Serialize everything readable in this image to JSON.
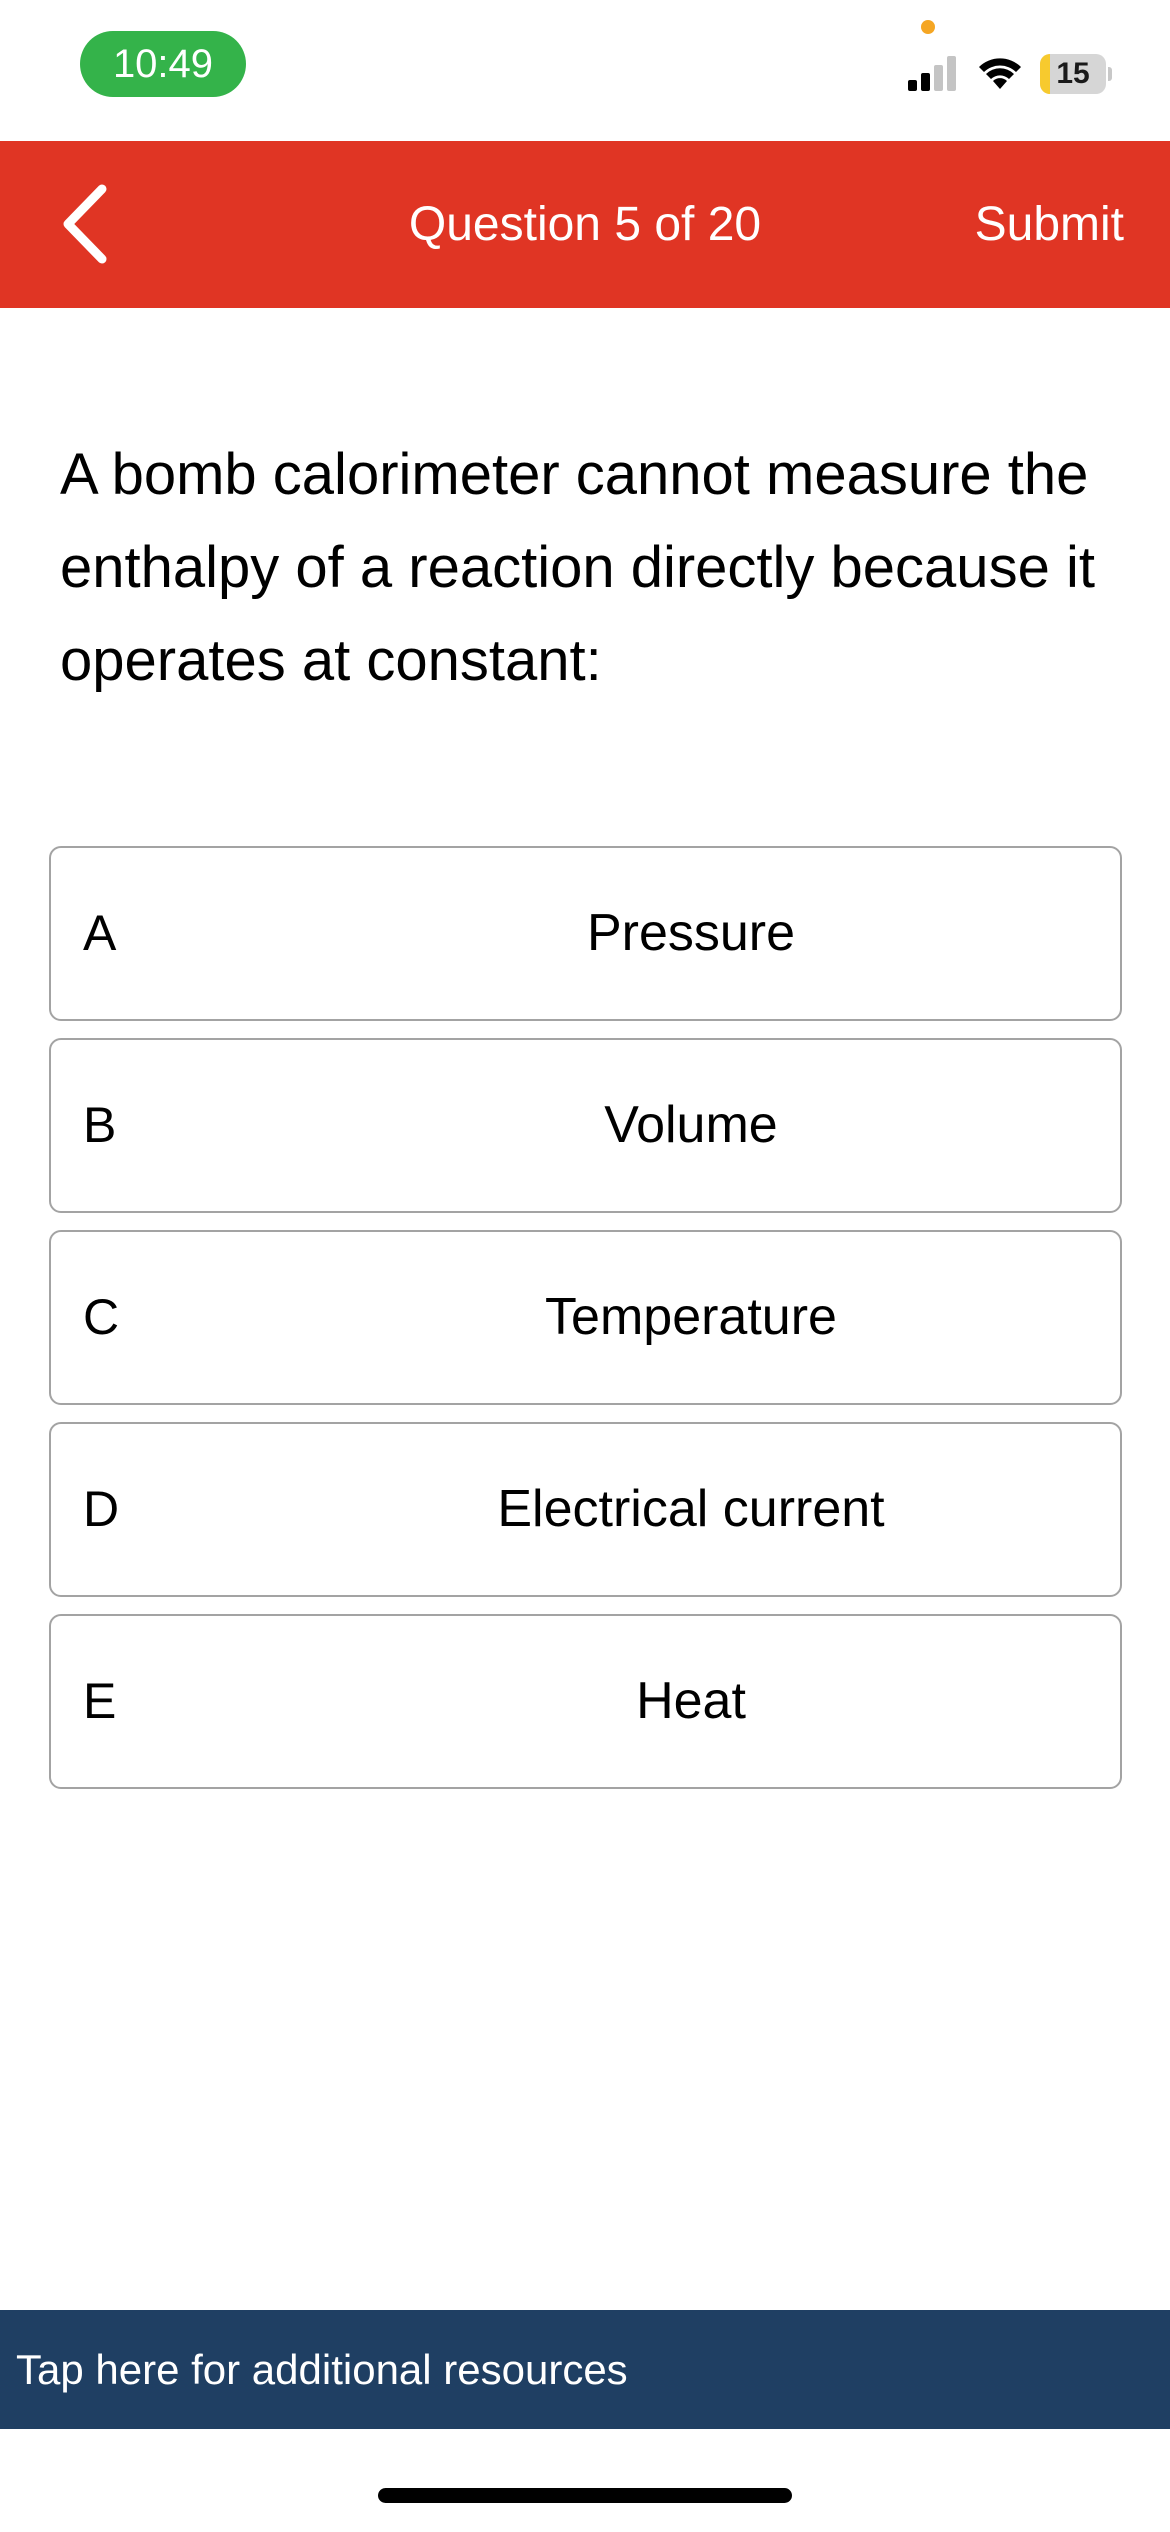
{
  "status_bar": {
    "time": "10:49",
    "battery_level": "15",
    "battery_fraction": 0.15,
    "icons": [
      "privacy-dot",
      "cellular-signal-icon",
      "wifi-icon",
      "battery-icon"
    ]
  },
  "header": {
    "title": "Question 5 of 20",
    "submit_label": "Submit",
    "back_icon": "chevron-left-icon",
    "background_color": "#e03524"
  },
  "question": {
    "text": "A bomb calorimeter cannot measure the enthalpy of a reaction directly because it operates at constant:"
  },
  "options": [
    {
      "letter": "A",
      "text": "Pressure"
    },
    {
      "letter": "B",
      "text": "Volume"
    },
    {
      "letter": "C",
      "text": "Temperature"
    },
    {
      "letter": "D",
      "text": "Electrical current"
    },
    {
      "letter": "E",
      "text": "Heat"
    }
  ],
  "resources": {
    "label": "Tap here for additional resources",
    "background_color": "#1f3f63"
  }
}
